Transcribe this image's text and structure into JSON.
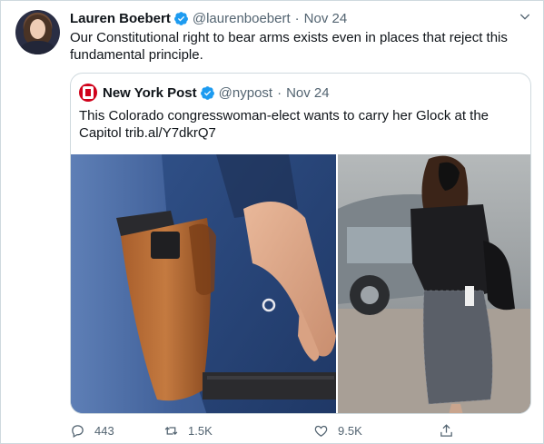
{
  "tweet": {
    "author_name": "Lauren Boebert",
    "author_handle": "@laurenboebert",
    "separator": "·",
    "date": "Nov 24",
    "text": "Our Constitutional right to bear arms exists even in places that reject this fundamental principle."
  },
  "quoted_tweet": {
    "author_name": "New York Post",
    "author_handle": "@nypost",
    "separator": "·",
    "date": "Nov 24",
    "text": "This Colorado congresswoman-elect wants to carry her Glock at the Capitol trib.al/Y7dkrQ7"
  },
  "actions": {
    "reply_count": "443",
    "retweet_count": "1.5K",
    "like_count": "9.5K"
  },
  "icons": {
    "verified": "verified-badge-icon",
    "more": "chevron-down-icon",
    "reply": "reply-icon",
    "retweet": "retweet-icon",
    "like": "heart-icon",
    "share": "share-icon"
  },
  "colors": {
    "accent": "#1d9bf0",
    "muted_text": "#536471",
    "text": "#0f1419",
    "border": "#cfd9de",
    "nypost_red": "#d0021b"
  }
}
